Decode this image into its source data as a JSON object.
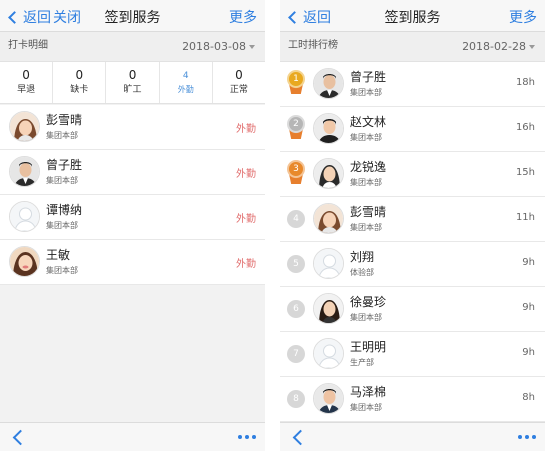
{
  "left": {
    "nav": {
      "back_label": "返回",
      "close_label": "关闭",
      "title": "签到服务",
      "more_label": "更多"
    },
    "section": {
      "title": "打卡明细",
      "date": "2018-03-08"
    },
    "stats": [
      {
        "value": "0",
        "label": "早退"
      },
      {
        "value": "0",
        "label": "缺卡"
      },
      {
        "value": "0",
        "label": "旷工"
      },
      {
        "value": "4",
        "label": "外勤"
      },
      {
        "value": "0",
        "label": "正常"
      }
    ],
    "rows": [
      {
        "name": "彭雪晴",
        "dept": "集团本部",
        "status": "外勤",
        "avatar": "female-avatar"
      },
      {
        "name": "曾子胜",
        "dept": "集团本部",
        "status": "外勤",
        "avatar": "male-avatar"
      },
      {
        "name": "谭博纳",
        "dept": "集团本部",
        "status": "外勤",
        "avatar": "default-avatar"
      },
      {
        "name": "王敏",
        "dept": "集团本部",
        "status": "外勤",
        "avatar": "female-avatar"
      }
    ]
  },
  "right": {
    "nav": {
      "back_label": "返回",
      "title": "签到服务",
      "more_label": "更多"
    },
    "section": {
      "title": "工时排行榜",
      "date": "2018-02-28"
    },
    "rows": [
      {
        "rank": "1",
        "name": "曾子胜",
        "dept": "集团本部",
        "hours": "18h"
      },
      {
        "rank": "2",
        "name": "赵文林",
        "dept": "集团本部",
        "hours": "16h"
      },
      {
        "rank": "3",
        "name": "龙锐逸",
        "dept": "集团本部",
        "hours": "15h"
      },
      {
        "rank": "4",
        "name": "彭雪晴",
        "dept": "集团本部",
        "hours": "11h"
      },
      {
        "rank": "5",
        "name": "刘翔",
        "dept": "体验部",
        "hours": "9h"
      },
      {
        "rank": "6",
        "name": "徐曼珍",
        "dept": "集团本部",
        "hours": "9h"
      },
      {
        "rank": "7",
        "name": "王明明",
        "dept": "生产部",
        "hours": "9h"
      },
      {
        "rank": "8",
        "name": "马泽棉",
        "dept": "集团本部",
        "hours": "8h"
      }
    ]
  },
  "colors": {
    "accent": "#2f7fe0",
    "status_red": "#e06a6a",
    "highlight_blue": "#4a90d9"
  }
}
